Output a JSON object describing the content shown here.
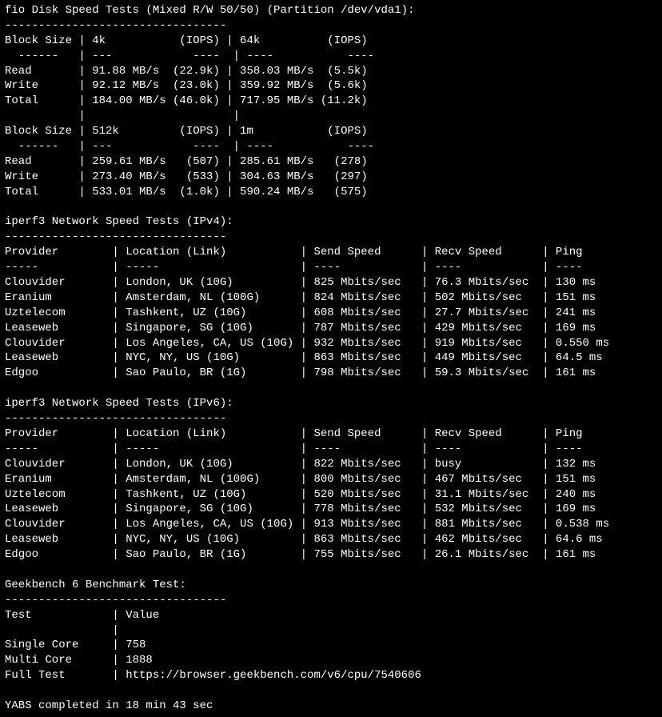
{
  "fio": {
    "title": "fio Disk Speed Tests (Mixed R/W 50/50) (Partition /dev/vda1):",
    "dashes": "---------------------------------",
    "header1_block": "Block Size",
    "header1_c1": "4k",
    "header1_c1_iops": "(IOPS)",
    "header1_c2": "64k",
    "header1_c2_iops": "(IOPS)",
    "dash_row": "  ------   | ---            ----  | ----           ---- ",
    "rows1": [
      {
        "label": "Read",
        "c1": "91.88 MB/s",
        "c1_iops": "(22.9k)",
        "c2": "358.03 MB/s",
        "c2_iops": "(5.5k)"
      },
      {
        "label": "Write",
        "c1": "92.12 MB/s",
        "c1_iops": "(23.0k)",
        "c2": "359.92 MB/s",
        "c2_iops": "(5.6k)"
      },
      {
        "label": "Total",
        "c1": "184.00 MB/s",
        "c1_iops": "(46.0k)",
        "c2": "717.95 MB/s",
        "c2_iops": "(11.2k)"
      }
    ],
    "header2_c1": "512k",
    "header2_c2": "1m",
    "rows2": [
      {
        "label": "Read",
        "c1": "259.61 MB/s",
        "c1_iops": "(507)",
        "c2": "285.61 MB/s",
        "c2_iops": "(278)"
      },
      {
        "label": "Write",
        "c1": "273.40 MB/s",
        "c1_iops": "(533)",
        "c2": "304.63 MB/s",
        "c2_iops": "(297)"
      },
      {
        "label": "Total",
        "c1": "533.01 MB/s",
        "c1_iops": "(1.0k)",
        "c2": "590.24 MB/s",
        "c2_iops": "(575)"
      }
    ]
  },
  "iperf4": {
    "title": "iperf3 Network Speed Tests (IPv4):",
    "dashes": "---------------------------------",
    "header": {
      "provider": "Provider",
      "location": "Location (Link)",
      "send": "Send Speed",
      "recv": "Recv Speed",
      "ping": "Ping"
    },
    "dash_row": "-----           | -----                     | ----            | ----            | ---- ",
    "rows": [
      {
        "provider": "Clouvider",
        "location": "London, UK (10G)",
        "send": "825 Mbits/sec",
        "recv": "76.3 Mbits/sec",
        "ping": "130 ms"
      },
      {
        "provider": "Eranium",
        "location": "Amsterdam, NL (100G)",
        "send": "824 Mbits/sec",
        "recv": "502 Mbits/sec",
        "ping": "151 ms"
      },
      {
        "provider": "Uztelecom",
        "location": "Tashkent, UZ (10G)",
        "send": "608 Mbits/sec",
        "recv": "27.7 Mbits/sec",
        "ping": "241 ms"
      },
      {
        "provider": "Leaseweb",
        "location": "Singapore, SG (10G)",
        "send": "787 Mbits/sec",
        "recv": "429 Mbits/sec",
        "ping": "169 ms"
      },
      {
        "provider": "Clouvider",
        "location": "Los Angeles, CA, US (10G)",
        "send": "932 Mbits/sec",
        "recv": "919 Mbits/sec",
        "ping": "0.550 ms"
      },
      {
        "provider": "Leaseweb",
        "location": "NYC, NY, US (10G)",
        "send": "863 Mbits/sec",
        "recv": "449 Mbits/sec",
        "ping": "64.5 ms"
      },
      {
        "provider": "Edgoo",
        "location": "Sao Paulo, BR (1G)",
        "send": "798 Mbits/sec",
        "recv": "59.3 Mbits/sec",
        "ping": "161 ms"
      }
    ]
  },
  "iperf6": {
    "title": "iperf3 Network Speed Tests (IPv6):",
    "dashes": "---------------------------------",
    "rows": [
      {
        "provider": "Clouvider",
        "location": "London, UK (10G)",
        "send": "822 Mbits/sec",
        "recv": "busy",
        "ping": "132 ms"
      },
      {
        "provider": "Eranium",
        "location": "Amsterdam, NL (100G)",
        "send": "800 Mbits/sec",
        "recv": "467 Mbits/sec",
        "ping": "151 ms"
      },
      {
        "provider": "Uztelecom",
        "location": "Tashkent, UZ (10G)",
        "send": "520 Mbits/sec",
        "recv": "31.1 Mbits/sec",
        "ping": "240 ms"
      },
      {
        "provider": "Leaseweb",
        "location": "Singapore, SG (10G)",
        "send": "778 Mbits/sec",
        "recv": "532 Mbits/sec",
        "ping": "169 ms"
      },
      {
        "provider": "Clouvider",
        "location": "Los Angeles, CA, US (10G)",
        "send": "913 Mbits/sec",
        "recv": "881 Mbits/sec",
        "ping": "0.538 ms"
      },
      {
        "provider": "Leaseweb",
        "location": "NYC, NY, US (10G)",
        "send": "863 Mbits/sec",
        "recv": "462 Mbits/sec",
        "ping": "64.6 ms"
      },
      {
        "provider": "Edgoo",
        "location": "Sao Paulo, BR (1G)",
        "send": "755 Mbits/sec",
        "recv": "26.1 Mbits/sec",
        "ping": "161 ms"
      }
    ]
  },
  "geekbench": {
    "title": "Geekbench 6 Benchmark Test:",
    "dashes": "---------------------------------",
    "header": {
      "test": "Test",
      "value": "Value"
    },
    "rows": [
      {
        "test": "Single Core",
        "value": "758"
      },
      {
        "test": "Multi Core",
        "value": "1888"
      },
      {
        "test": "Full Test",
        "value": "https://browser.geekbench.com/v6/cpu/7540606"
      }
    ]
  },
  "footer": "YABS completed in 18 min 43 sec"
}
